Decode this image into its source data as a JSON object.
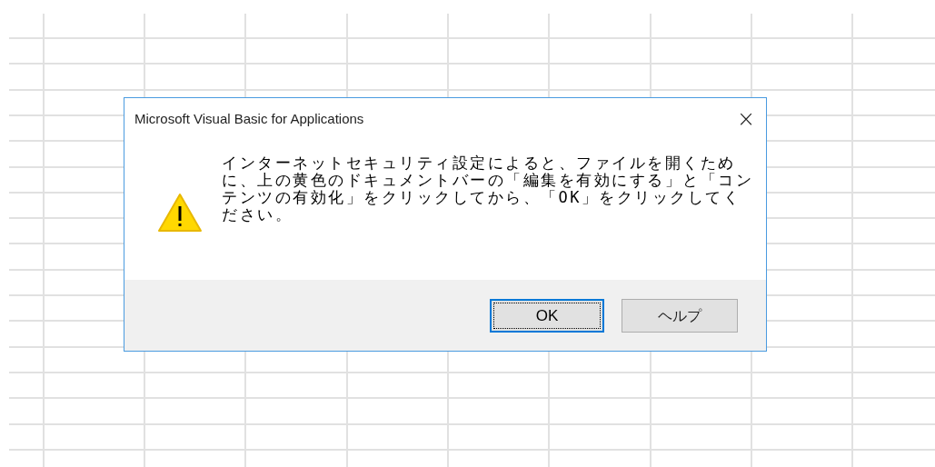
{
  "dialog": {
    "title": "Microsoft Visual Basic for Applications",
    "close": "×",
    "message": "インターネットセキュリティ設定によると、ファイルを開くために、上の黄色のドキュメントバーの「編集を有効にする」と「コンテンツの有効化」をクリックしてから、「OK」をクリックしてください。",
    "buttons": [
      {
        "label": "OK",
        "selected": true
      },
      {
        "label": "ヘルプ",
        "selected": false
      }
    ]
  }
}
